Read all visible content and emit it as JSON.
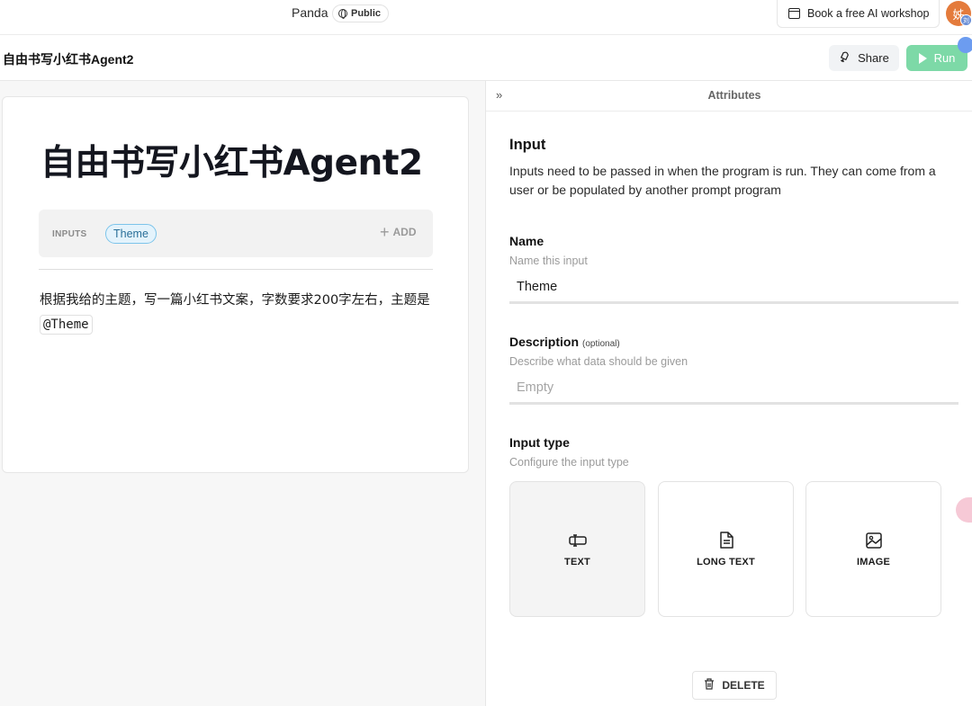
{
  "topbar": {
    "brand": "Panda",
    "visibility": "Public",
    "workshop_label": "Book a free AI workshop",
    "avatar_text": "姊",
    "avatar_sub_text": "刘"
  },
  "header": {
    "title": "自由书写小红书Agent2",
    "share_label": "Share",
    "run_label": "Run"
  },
  "editor": {
    "title": "自由书写小红书Agent2",
    "inputs_label": "INPUTS",
    "input_chip": "Theme",
    "add_label": "ADD",
    "prompt_text": "根据我给的主题，写一篇小红书文案，字数要求200字左右，主题是",
    "mention": "@Theme"
  },
  "attributes": {
    "panel_title": "Attributes",
    "section_title": "Input",
    "section_desc": "Inputs need to be passed in when the program is run. They can come from a user or be populated by another prompt program",
    "name": {
      "label": "Name",
      "hint": "Name this input",
      "value": "Theme"
    },
    "description": {
      "label": "Description",
      "optional": "(optional)",
      "hint": "Describe what data should be given",
      "placeholder": "Empty"
    },
    "input_type": {
      "label": "Input type",
      "hint": "Configure the input type",
      "options": [
        {
          "label": "TEXT",
          "icon": "text-cursor-icon",
          "selected": true
        },
        {
          "label": "LONG TEXT",
          "icon": "document-icon",
          "selected": false
        },
        {
          "label": "IMAGE",
          "icon": "image-icon",
          "selected": false
        }
      ]
    },
    "delete_label": "DELETE"
  },
  "colors": {
    "run_button": "#7dd9a7",
    "chip_border": "#7cc4ea",
    "chip_bg": "#e4f3fc",
    "avatar": "#e47b3c"
  }
}
